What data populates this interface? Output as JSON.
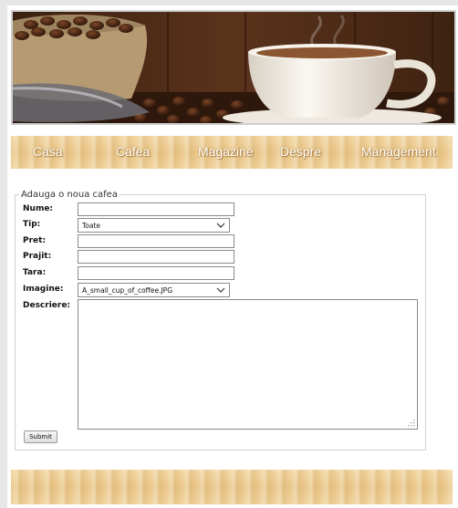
{
  "nav": {
    "items": [
      {
        "label": "Casa"
      },
      {
        "label": "Cafea"
      },
      {
        "label": "Magazine"
      },
      {
        "label": "Despre"
      },
      {
        "label": "Management"
      }
    ]
  },
  "form": {
    "legend": "Adauga o noua cafea",
    "labels": {
      "nume": "Nume:",
      "tip": "Tip:",
      "pret": "Pret:",
      "prajit": "Prajit:",
      "tara": "Tara:",
      "imagine": "Imagine:",
      "descriere": "Descriere:"
    },
    "values": {
      "nume": "",
      "pret": "",
      "prajit": "",
      "tara": "",
      "descriere": ""
    },
    "tip_selected": "Toate",
    "imagine_selected": "A_small_cup_of_coffee.JPG",
    "submit_label": "Submit"
  },
  "colors": {
    "wood_light": "#f2d6a2",
    "wood_mid": "#eac78a",
    "nav_text": "#ffffff",
    "coffee_dark": "#2a160c"
  }
}
